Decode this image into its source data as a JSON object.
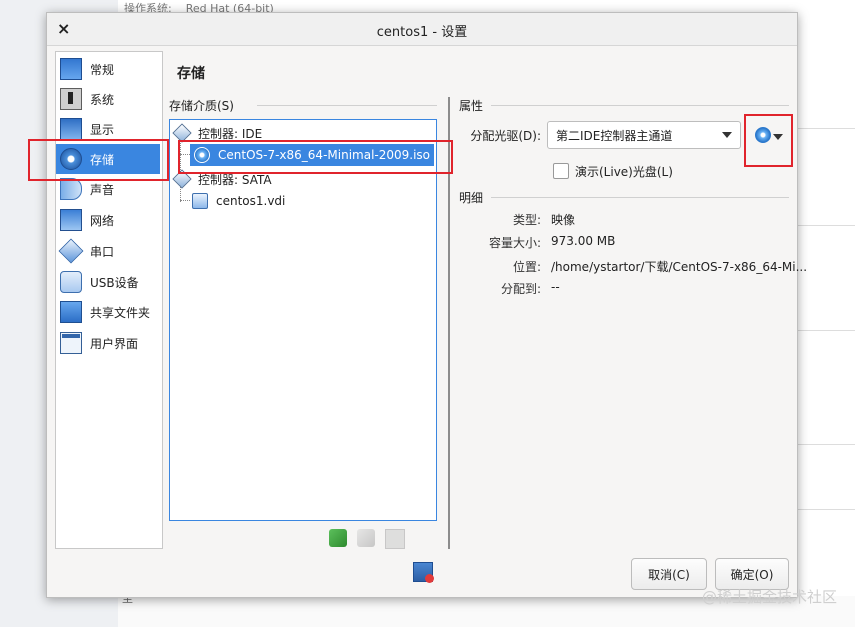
{
  "background": {
    "os_label": "操作系统:",
    "os_value": "Red Hat (64-bit)",
    "bottom_char": "至",
    "watermark": "@稀土掘金技术社区"
  },
  "dialog": {
    "title": "centos1 - 设置",
    "close": "×",
    "page_title": "存储"
  },
  "sidebar": {
    "items": [
      {
        "label": "常规",
        "icon": "general-icon"
      },
      {
        "label": "系统",
        "icon": "system-icon"
      },
      {
        "label": "显示",
        "icon": "display-icon"
      },
      {
        "label": "存储",
        "icon": "storage-icon",
        "selected": true
      },
      {
        "label": "声音",
        "icon": "audio-icon"
      },
      {
        "label": "网络",
        "icon": "network-icon"
      },
      {
        "label": "串口",
        "icon": "serial-port-icon"
      },
      {
        "label": "USB设备",
        "icon": "usb-icon"
      },
      {
        "label": "共享文件夹",
        "icon": "shared-folder-icon"
      },
      {
        "label": "用户界面",
        "icon": "user-interface-icon"
      }
    ]
  },
  "storage": {
    "section_label": "存储介质(S)",
    "tree": [
      {
        "label": "控制器: IDE",
        "type": "controller"
      },
      {
        "label": "CentOS-7-x86_64-Minimal-2009.iso",
        "type": "optical",
        "selected": true
      },
      {
        "label": "控制器: SATA",
        "type": "controller"
      },
      {
        "label": "centos1.vdi",
        "type": "hard-disk"
      }
    ]
  },
  "properties": {
    "section_label": "属性",
    "drive_label": "分配光驱(D):",
    "drive_value": "第二IDE控制器主通道",
    "live_cd_label": "演示(Live)光盘(L)",
    "live_cd_checked": false
  },
  "details": {
    "section_label": "明细",
    "rows": [
      {
        "key": "类型:",
        "value": "映像"
      },
      {
        "key": "容量大小:",
        "value": "973.00 MB"
      },
      {
        "key": "位置:",
        "value": "/home/ystartor/下载/CentOS-7-x86_64-Mi..."
      },
      {
        "key": "分配到:",
        "value": "--"
      }
    ]
  },
  "buttons": {
    "cancel": "取消(C)",
    "ok": "确定(O)"
  },
  "colors": {
    "selection": "#3a86e0",
    "annotation": "#e0242c"
  }
}
